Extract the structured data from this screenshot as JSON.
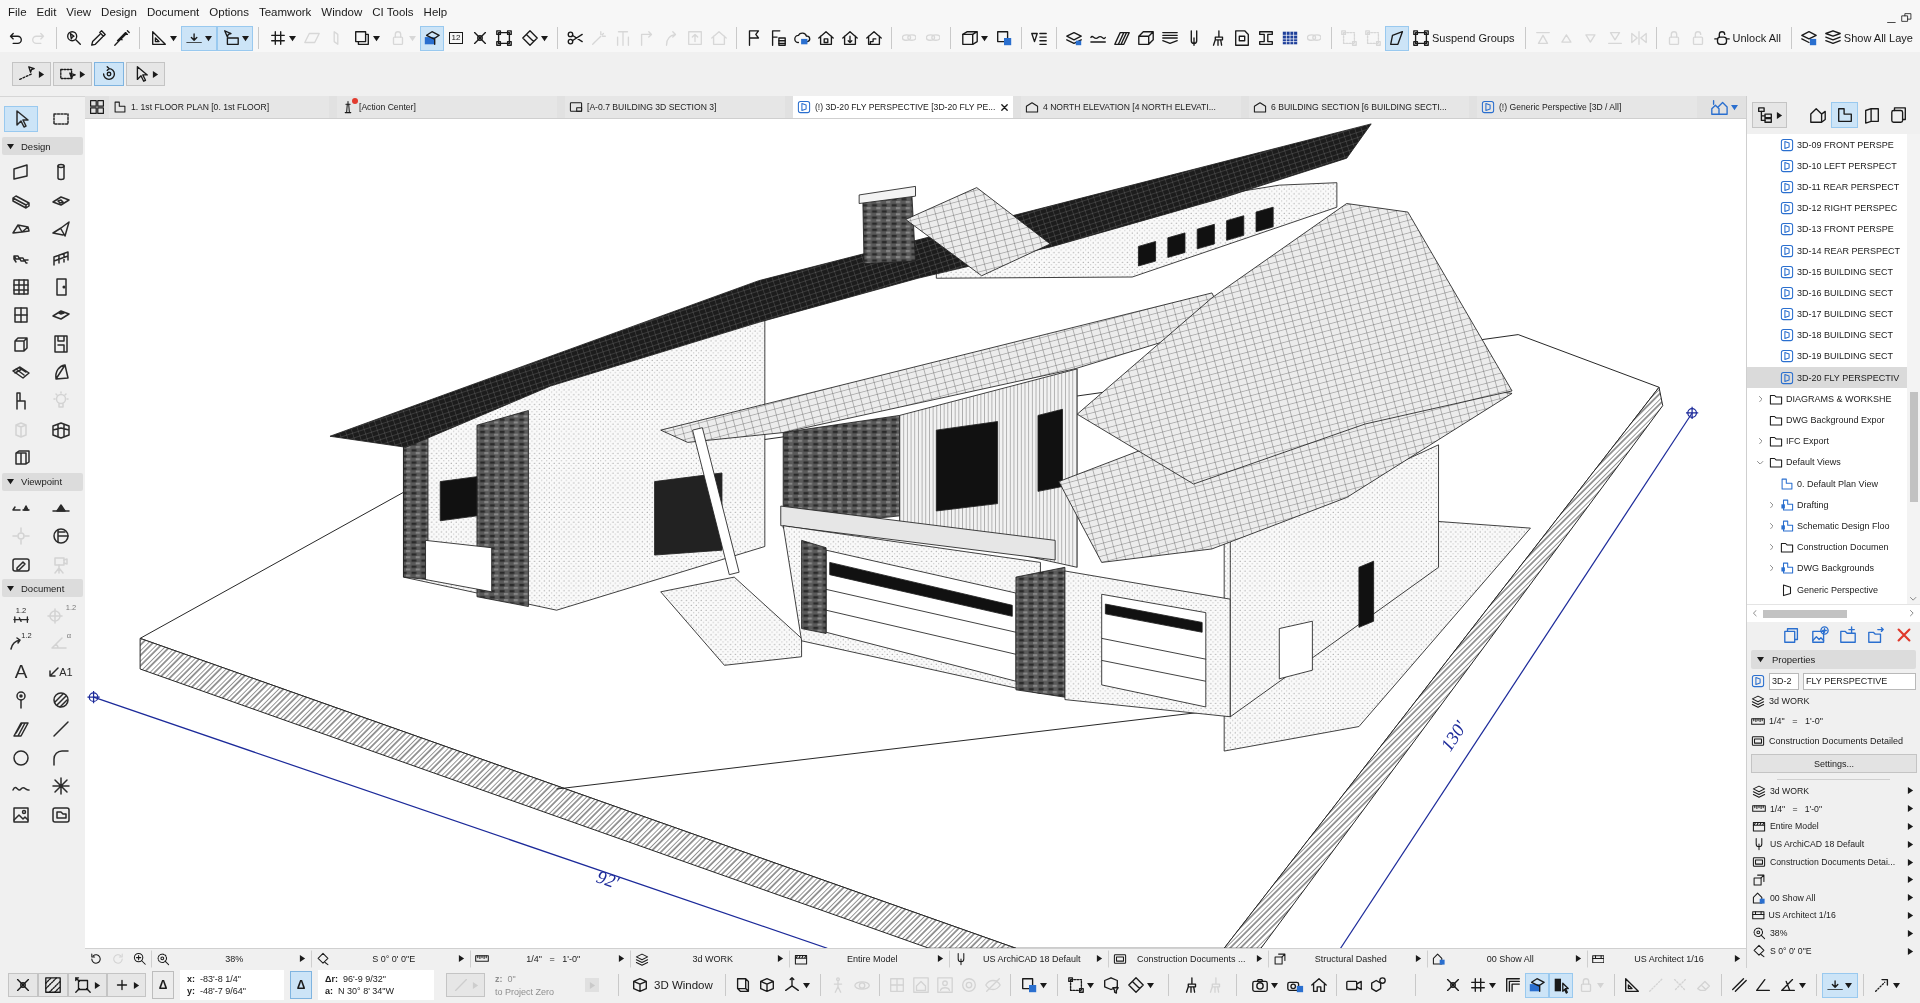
{
  "menu": [
    "File",
    "Edit",
    "View",
    "Design",
    "Document",
    "Options",
    "Teamwork",
    "Window",
    "CI Tools",
    "Help"
  ],
  "toolbar": [
    {
      "kind": "button",
      "selected": false,
      "disabled": false
    },
    {
      "kind": "button",
      "selected": false,
      "disabled": true
    },
    {
      "kind": "separator"
    },
    {
      "kind": "button",
      "selected": false,
      "disabled": false
    },
    {
      "kind": "button",
      "selected": false,
      "disabled": false
    },
    {
      "kind": "button",
      "selected": false,
      "disabled": false
    },
    {
      "kind": "separator"
    },
    {
      "kind": "dropdown",
      "selected": false,
      "disabled": false
    },
    {
      "kind": "dropdown",
      "selected": true,
      "disabled": false
    },
    {
      "kind": "dropdown",
      "selected": true,
      "disabled": false
    },
    {
      "kind": "separator"
    },
    {
      "kind": "dropdown",
      "selected": false,
      "disabled": false
    },
    {
      "kind": "button",
      "selected": false,
      "disabled": true
    },
    {
      "kind": "button",
      "selected": false,
      "disabled": true
    },
    {
      "kind": "dropdown",
      "selected": false,
      "disabled": false
    },
    {
      "kind": "dropdown",
      "selected": false,
      "disabled": true
    },
    {
      "kind": "button",
      "selected": true,
      "disabled": false
    },
    {
      "kind": "button",
      "selected": false,
      "disabled": false,
      "text": "12"
    },
    {
      "kind": "button",
      "selected": false,
      "disabled": false
    },
    {
      "kind": "button",
      "selected": false,
      "disabled": false
    },
    {
      "kind": "dropdown",
      "selected": false,
      "disabled": false
    },
    {
      "kind": "separator"
    },
    {
      "kind": "button",
      "selected": false,
      "disabled": false
    },
    {
      "kind": "button",
      "selected": false,
      "disabled": true
    },
    {
      "kind": "button",
      "selected": false,
      "disabled": true
    },
    {
      "kind": "button",
      "selected": false,
      "disabled": true
    },
    {
      "kind": "button",
      "selected": false,
      "disabled": true
    },
    {
      "kind": "button",
      "selected": false,
      "disabled": true
    },
    {
      "kind": "button",
      "selected": false,
      "disabled": true
    },
    {
      "kind": "separator"
    },
    {
      "kind": "button",
      "selected": false,
      "disabled": false
    },
    {
      "kind": "button",
      "selected": false,
      "disabled": false
    },
    {
      "kind": "button",
      "selected": false,
      "disabled": false
    },
    {
      "kind": "button",
      "selected": false,
      "disabled": false
    },
    {
      "kind": "button",
      "selected": false,
      "disabled": false
    },
    {
      "kind": "button",
      "selected": false,
      "disabled": false
    },
    {
      "kind": "separator"
    },
    {
      "kind": "button",
      "selected": false,
      "disabled": true
    },
    {
      "kind": "button",
      "selected": false,
      "disabled": true
    },
    {
      "kind": "separator"
    },
    {
      "kind": "dropdown",
      "selected": false,
      "disabled": false
    },
    {
      "kind": "button",
      "selected": false,
      "disabled": false
    },
    {
      "kind": "separator"
    },
    {
      "kind": "button",
      "selected": false,
      "disabled": false
    },
    {
      "kind": "separator"
    },
    {
      "kind": "button",
      "selected": false,
      "disabled": false
    },
    {
      "kind": "button",
      "selected": false,
      "disabled": false
    },
    {
      "kind": "button",
      "selected": false,
      "disabled": false
    },
    {
      "kind": "button",
      "selected": false,
      "disabled": false
    },
    {
      "kind": "button",
      "selected": false,
      "disabled": false
    },
    {
      "kind": "button",
      "selected": false,
      "disabled": false
    },
    {
      "kind": "button",
      "selected": false,
      "disabled": false
    },
    {
      "kind": "button",
      "selected": false,
      "disabled": false
    },
    {
      "kind": "button",
      "selected": false,
      "disabled": false
    },
    {
      "kind": "button",
      "selected": false,
      "disabled": false
    },
    {
      "kind": "button",
      "selected": false,
      "disabled": true
    },
    {
      "kind": "separator"
    },
    {
      "kind": "button",
      "selected": false,
      "disabled": true
    },
    {
      "kind": "button",
      "selected": false,
      "disabled": true
    },
    {
      "kind": "button",
      "selected": true,
      "disabled": false
    },
    {
      "kind": "button",
      "selected": false,
      "disabled": false,
      "text": "Suspend Groups"
    },
    {
      "kind": "separator"
    },
    {
      "kind": "button",
      "selected": false,
      "disabled": true
    },
    {
      "kind": "button",
      "selected": false,
      "disabled": true
    },
    {
      "kind": "button",
      "selected": false,
      "disabled": true
    },
    {
      "kind": "button",
      "selected": false,
      "disabled": true
    },
    {
      "kind": "button",
      "selected": false,
      "disabled": true
    },
    {
      "kind": "separator"
    },
    {
      "kind": "button",
      "selected": false,
      "disabled": true
    },
    {
      "kind": "button",
      "selected": false,
      "disabled": true
    },
    {
      "kind": "button",
      "selected": false,
      "disabled": false,
      "text": "Unlock All"
    },
    {
      "kind": "separator"
    },
    {
      "kind": "button",
      "selected": false,
      "disabled": false
    },
    {
      "kind": "button",
      "selected": false,
      "disabled": false,
      "text": "Show All Laye"
    }
  ],
  "toolbar_2": [
    {
      "kind": "dropdown",
      "selected": false
    },
    {
      "kind": "dropdown",
      "selected": false
    },
    {
      "kind": "button",
      "selected": true
    },
    {
      "kind": "dropdown",
      "selected": false
    }
  ],
  "toolbox": {
    "top": [
      {
        "selected": true,
        "disabled": false
      },
      {
        "selected": false,
        "disabled": false
      }
    ],
    "sections": [
      {
        "title": "Design",
        "expanded": true,
        "tools": [
          {
            "selected": false,
            "disabled": false
          },
          {
            "selected": false,
            "disabled": false
          },
          {
            "selected": false,
            "disabled": false
          },
          {
            "selected": false,
            "disabled": false
          },
          {
            "selected": false,
            "disabled": false
          },
          {
            "selected": false,
            "disabled": false
          },
          {
            "selected": false,
            "disabled": false
          },
          {
            "selected": false,
            "disabled": false
          },
          {
            "selected": false,
            "disabled": false
          },
          {
            "selected": false,
            "disabled": false
          },
          {
            "selected": false,
            "disabled": false
          },
          {
            "selected": false,
            "disabled": false
          },
          {
            "selected": false,
            "disabled": false
          },
          {
            "selected": false,
            "disabled": false
          },
          {
            "selected": false,
            "disabled": false
          },
          {
            "selected": false,
            "disabled": false
          },
          {
            "selected": false,
            "disabled": false
          },
          {
            "selected": false,
            "disabled": true
          },
          {
            "selected": false,
            "disabled": true
          },
          {
            "selected": false,
            "disabled": false
          },
          {
            "selected": false,
            "disabled": false
          }
        ]
      },
      {
        "title": "Viewpoint",
        "expanded": true,
        "tools": [
          {
            "selected": false,
            "disabled": false
          },
          {
            "selected": false,
            "disabled": false
          },
          {
            "selected": false,
            "disabled": true
          },
          {
            "selected": false,
            "disabled": false
          },
          {
            "selected": false,
            "disabled": false
          },
          {
            "selected": false,
            "disabled": true
          }
        ]
      },
      {
        "title": "Document",
        "expanded": true,
        "tools": [
          {
            "selected": false,
            "disabled": false,
            "text": "1.2"
          },
          {
            "selected": false,
            "disabled": true,
            "text": "1.2"
          },
          {
            "selected": false,
            "disabled": false,
            "text": "1.2"
          },
          {
            "selected": false,
            "disabled": true,
            "text": "α"
          },
          {
            "selected": false,
            "disabled": false,
            "text": "A"
          },
          {
            "selected": false,
            "disabled": false,
            "text": "A1"
          },
          {
            "selected": false,
            "disabled": false
          },
          {
            "selected": false,
            "disabled": false
          },
          {
            "selected": false,
            "disabled": false
          },
          {
            "selected": false,
            "disabled": false
          },
          {
            "selected": false,
            "disabled": false
          },
          {
            "selected": false,
            "disabled": false
          },
          {
            "selected": false,
            "disabled": false
          },
          {
            "selected": false,
            "disabled": false
          },
          {
            "selected": false,
            "disabled": false
          },
          {
            "selected": false,
            "disabled": false
          }
        ]
      }
    ]
  },
  "tabs": [
    {
      "label": "1. 1st FLOOR PLAN [0. 1st FLOOR]",
      "kind": "plan",
      "selected": false,
      "notification": false
    },
    {
      "label": "[Action Center]",
      "kind": "action",
      "selected": false,
      "notification": true
    },
    {
      "label": "[A-0.7 BUILDING 3D SECTION 3]",
      "kind": "worksheet",
      "selected": false,
      "notification": false
    },
    {
      "label": "(!) 3D-20 FLY PERSPECTIVE [3D-20 FLY PE...",
      "kind": "view-3d",
      "selected": true,
      "notification": false
    },
    {
      "label": "4 NORTH ELEVATION [4 NORTH ELEVATI...",
      "kind": "elevation",
      "selected": false,
      "notification": false
    },
    {
      "label": "6 BUILDING SECTION [6 BUILDING SECTI...",
      "kind": "section",
      "selected": false,
      "notification": false
    },
    {
      "label": "(!) Generic Perspective [3D / All]",
      "kind": "view-3d",
      "selected": false,
      "notification": false
    }
  ],
  "viewport": {
    "dimension_labels": [
      "92'",
      "130'"
    ]
  },
  "quick_options": {
    "tools": [
      {
        "disabled": false
      },
      {
        "disabled": true
      },
      {
        "disabled": false
      }
    ],
    "dropdowns": [
      {
        "kind": "zoom",
        "value": "38%"
      },
      {
        "kind": "orientation",
        "value": "S 0° 0' 0\"E"
      },
      {
        "kind": "scale",
        "value": "1/4\"   =   1'-0\""
      },
      {
        "kind": "layers",
        "value": "3d WORK"
      },
      {
        "kind": "structure",
        "value": "Entire Model"
      },
      {
        "kind": "pen",
        "value": "US ArchiCAD 18 Default"
      },
      {
        "kind": "model-view",
        "value": "Construction Documents ..."
      },
      {
        "kind": "override",
        "value": "Structural Dashed"
      },
      {
        "kind": "renovation",
        "value": "00 Show All"
      },
      {
        "kind": "dimension",
        "value": "US Architect 1/16"
      }
    ]
  },
  "navigator": {
    "modes": [
      {
        "selected": false
      },
      {
        "selected": true
      },
      {
        "selected": false
      },
      {
        "selected": false
      }
    ],
    "tree": [
      {
        "children": [
          {
            "label": "3D-09 FRONT PERSPE",
            "kind": "view-3d",
            "selected": false
          },
          {
            "label": "3D-10 LEFT PERSPECT",
            "kind": "view-3d",
            "selected": false
          },
          {
            "label": "3D-11 REAR PERSPECT",
            "kind": "view-3d",
            "selected": false
          },
          {
            "label": "3D-12 RIGHT PERSPEC",
            "kind": "view-3d",
            "selected": false
          },
          {
            "label": "3D-13 FRONT PERSPE",
            "kind": "view-3d",
            "selected": false
          },
          {
            "label": "3D-14 REAR PERSPECT",
            "kind": "view-3d",
            "selected": false
          },
          {
            "label": "3D-15 BUILDING SECT",
            "kind": "view-3d",
            "selected": false
          },
          {
            "label": "3D-16 BUILDING SECT",
            "kind": "view-3d",
            "selected": false
          },
          {
            "label": "3D-17 BUILDING SECT",
            "kind": "view-3d",
            "selected": false
          },
          {
            "label": "3D-18 BUILDING SECT",
            "kind": "view-3d",
            "selected": false
          },
          {
            "label": "3D-19 BUILDING SECT",
            "kind": "view-3d",
            "selected": false
          },
          {
            "label": "3D-20 FLY PERSPECTIV",
            "kind": "view-3d",
            "selected": true
          }
        ]
      },
      {
        "label": "DIAGRAMS & WORKSHE",
        "kind": "folder",
        "expanded": false,
        "selected": false
      },
      {
        "label": "DWG Background Expor",
        "kind": "folder",
        "selected": false
      },
      {
        "label": "IFC Export",
        "kind": "folder",
        "expanded": false,
        "selected": false
      },
      {
        "label": "Default Views",
        "kind": "folder",
        "expanded": true,
        "selected": false,
        "children": [
          {
            "label": "0. Default Plan View",
            "kind": "plan",
            "selected": false
          },
          {
            "label": "Drafting",
            "kind": "clone",
            "expanded": false,
            "selected": false
          },
          {
            "label": "Schematic Design Floo",
            "kind": "clone",
            "expanded": false,
            "selected": false
          },
          {
            "label": "Construction Documen",
            "kind": "folder",
            "expanded": false,
            "selected": false
          },
          {
            "label": "DWG Backgrounds",
            "kind": "clone",
            "expanded": false,
            "selected": false
          },
          {
            "label": "Generic Perspective",
            "kind": "perspective",
            "selected": false
          }
        ]
      }
    ]
  },
  "properties": {
    "title": "Properties",
    "expanded": true,
    "view_id": "3D-2",
    "view_name": "FLY PERSPECTIVE",
    "info": [
      {
        "kind": "layers",
        "label": "3d WORK"
      },
      {
        "kind": "scale",
        "label": "1/4\"   =   1'-0\""
      },
      {
        "kind": "model-view",
        "label": "Construction Documents Detailed"
      }
    ],
    "settings_button": "Settings...",
    "options": [
      {
        "kind": "layers",
        "label": "3d WORK"
      },
      {
        "kind": "scale",
        "label": "1/4\"   =   1'-0\""
      },
      {
        "kind": "structure",
        "label": "Entire Model"
      },
      {
        "kind": "pen",
        "label": "US ArchiCAD 18 Default"
      },
      {
        "kind": "model-view",
        "label": "Construction Documents Detai..."
      },
      {
        "kind": "override"
      },
      {
        "kind": "renovation",
        "label": "00 Show All"
      },
      {
        "kind": "dimension",
        "label": "US Architect 1/16"
      },
      {
        "kind": "zoom",
        "label": "38%"
      },
      {
        "kind": "orientation",
        "label": "S 0° 0' 0\"E"
      }
    ]
  },
  "bottom_bar": {
    "snap_tools": [
      {
        "kind": "button",
        "selected": false
      },
      {
        "kind": "button",
        "selected": false
      },
      {
        "kind": "dropdown",
        "selected": false
      },
      {
        "kind": "dropdown",
        "selected": false
      }
    ],
    "tracker": {
      "relative_left": {
        "text": "Δ",
        "selected": false
      },
      "coords": [
        {
          "label": "x:",
          "value": "-83'-8 1/4\""
        },
        {
          "label": "y:",
          "value": "-48'-7 9/64\""
        }
      ],
      "relative_right": {
        "text": "Δ",
        "selected": true
      },
      "polar": [
        {
          "label": "Δr:",
          "value": "96'-9 9/32\""
        },
        {
          "label": "a:",
          "value": "N 30° 8' 34\"W"
        }
      ],
      "line_tool": {
        "kind": "dropdown",
        "disabled": true
      },
      "z": {
        "label": "z:",
        "value": "0\"",
        "reference": "to Project Zero",
        "disabled": true
      }
    },
    "window_button": "3D Window",
    "tools": [
      {
        "kind": "button",
        "selected": false,
        "disabled": false
      },
      {
        "kind": "button",
        "selected": false,
        "disabled": false
      },
      {
        "kind": "dropdown",
        "selected": false,
        "disabled": false
      },
      {
        "kind": "separator"
      },
      {
        "kind": "button",
        "selected": false,
        "disabled": true
      },
      {
        "kind": "button",
        "selected": false,
        "disabled": true
      },
      {
        "kind": "separator"
      },
      {
        "kind": "button",
        "selected": false,
        "disabled": true
      },
      {
        "kind": "button",
        "selected": false,
        "disabled": true
      },
      {
        "kind": "button",
        "selected": false,
        "disabled": true
      },
      {
        "kind": "button",
        "selected": false,
        "disabled": true
      },
      {
        "kind": "button",
        "selected": false,
        "disabled": true
      },
      {
        "kind": "separator"
      },
      {
        "kind": "dropdown",
        "selected": false,
        "disabled": false
      },
      {
        "kind": "separator"
      },
      {
        "kind": "dropdown",
        "selected": false,
        "disabled": false
      },
      {
        "kind": "button",
        "selected": false,
        "disabled": false
      },
      {
        "kind": "dropdown",
        "selected": false,
        "disabled": false
      },
      {
        "kind": "separator"
      },
      {
        "kind": "button",
        "selected": false,
        "disabled": false
      },
      {
        "kind": "button",
        "selected": false,
        "disabled": true
      },
      {
        "kind": "separator"
      },
      {
        "kind": "dropdown",
        "selected": false,
        "disabled": false
      },
      {
        "kind": "button",
        "selected": false,
        "disabled": false
      },
      {
        "kind": "button",
        "selected": false,
        "disabled": false
      },
      {
        "kind": "separator"
      },
      {
        "kind": "button",
        "selected": false,
        "disabled": false
      },
      {
        "kind": "button",
        "selected": false,
        "disabled": false
      },
      {
        "kind": "separator"
      },
      {
        "kind": "button",
        "selected": false,
        "disabled": false
      },
      {
        "kind": "dropdown",
        "selected": false,
        "disabled": false
      },
      {
        "kind": "button",
        "selected": false,
        "disabled": false
      },
      {
        "kind": "button",
        "selected": true,
        "disabled": false
      },
      {
        "kind": "button",
        "selected": true,
        "disabled": false
      },
      {
        "kind": "dropdown",
        "selected": false,
        "disabled": true
      },
      {
        "kind": "separator"
      },
      {
        "kind": "button",
        "selected": false,
        "disabled": false
      },
      {
        "kind": "button",
        "selected": false,
        "disabled": true
      },
      {
        "kind": "button",
        "selected": false,
        "disabled": true
      },
      {
        "kind": "button",
        "selected": false,
        "disabled": true
      },
      {
        "kind": "separator"
      },
      {
        "kind": "button",
        "selected": false,
        "disabled": false
      },
      {
        "kind": "button",
        "selected": false,
        "disabled": false
      },
      {
        "kind": "dropdown",
        "selected": false,
        "disabled": false
      },
      {
        "kind": "separator"
      },
      {
        "kind": "dropdown",
        "selected": true,
        "disabled": false
      },
      {
        "kind": "separator"
      },
      {
        "kind": "dropdown",
        "selected": false,
        "disabled": false
      }
    ]
  }
}
